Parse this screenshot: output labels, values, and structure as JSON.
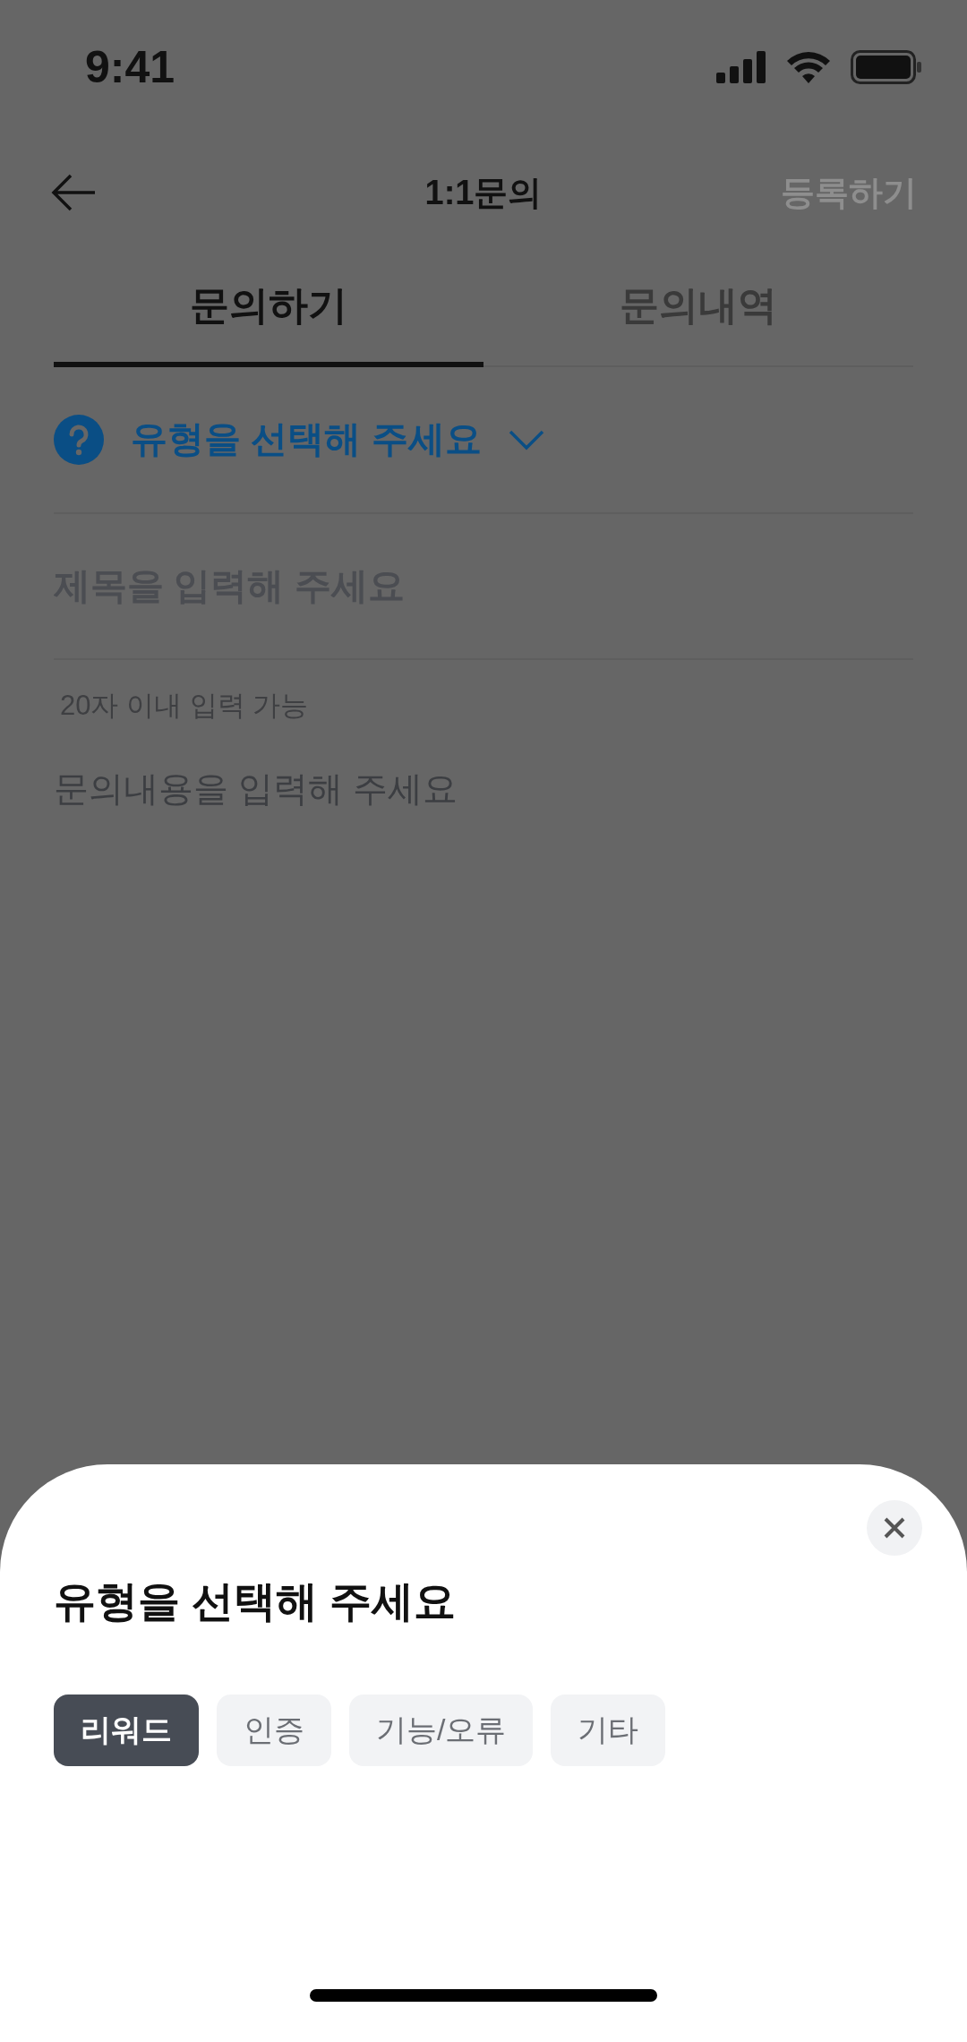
{
  "status_bar": {
    "time": "9:41"
  },
  "nav": {
    "title": "1:1문의",
    "action": {
      "label": "등록하기",
      "disabled": true
    }
  },
  "tabs": [
    {
      "label": "문의하기",
      "selected": true
    },
    {
      "label": "문의내역",
      "selected": false
    }
  ],
  "type_selector": {
    "label": "유형을 선택해 주세요"
  },
  "title_field": {
    "placeholder": "제목을 입력해 주세요"
  },
  "title_hint": "20자 이내 입력 가능",
  "content_field": {
    "placeholder": "문의내용을 입력해 주세요"
  },
  "sheet": {
    "title": "유형을 선택해 주세요",
    "options": [
      {
        "label": "리워드",
        "selected": true
      },
      {
        "label": "인증",
        "selected": false
      },
      {
        "label": "기능/오류",
        "selected": false
      },
      {
        "label": "기타",
        "selected": false
      }
    ]
  }
}
